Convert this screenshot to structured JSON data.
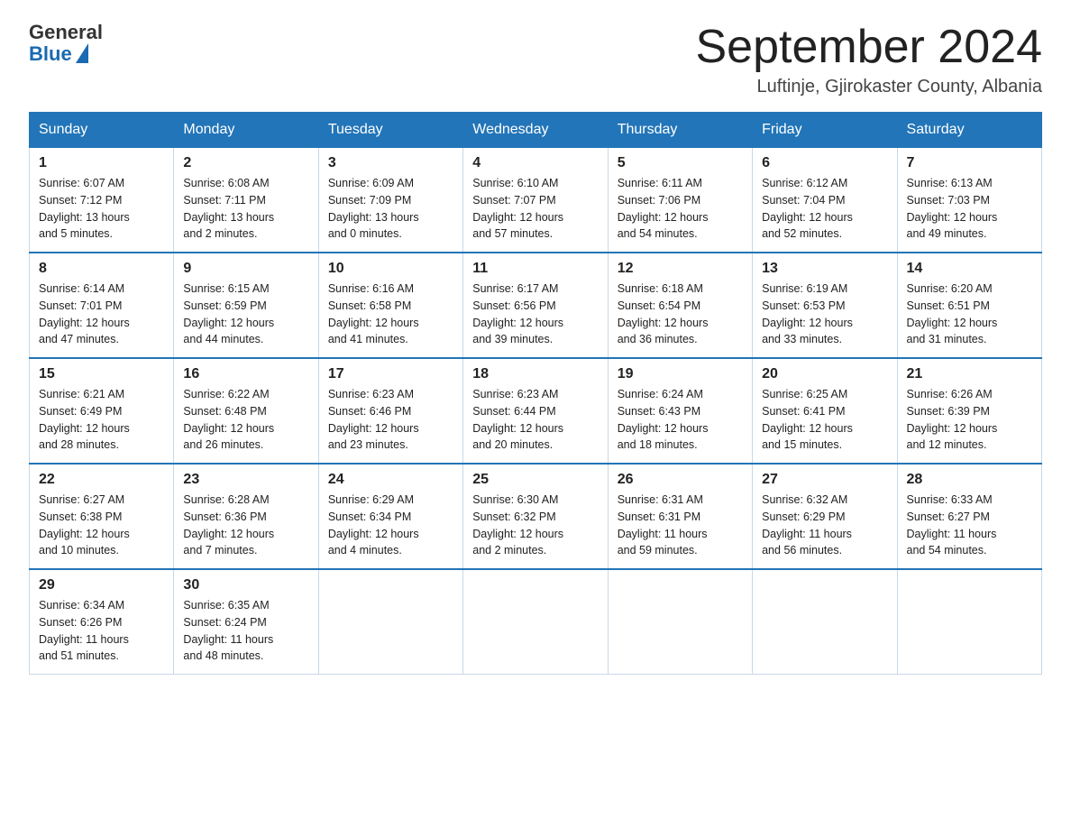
{
  "header": {
    "logo_general": "General",
    "logo_blue": "Blue",
    "month_title": "September 2024",
    "location": "Luftinje, Gjirokaster County, Albania"
  },
  "days_of_week": [
    "Sunday",
    "Monday",
    "Tuesday",
    "Wednesday",
    "Thursday",
    "Friday",
    "Saturday"
  ],
  "weeks": [
    [
      {
        "day": "1",
        "info": "Sunrise: 6:07 AM\nSunset: 7:12 PM\nDaylight: 13 hours\nand 5 minutes."
      },
      {
        "day": "2",
        "info": "Sunrise: 6:08 AM\nSunset: 7:11 PM\nDaylight: 13 hours\nand 2 minutes."
      },
      {
        "day": "3",
        "info": "Sunrise: 6:09 AM\nSunset: 7:09 PM\nDaylight: 13 hours\nand 0 minutes."
      },
      {
        "day": "4",
        "info": "Sunrise: 6:10 AM\nSunset: 7:07 PM\nDaylight: 12 hours\nand 57 minutes."
      },
      {
        "day": "5",
        "info": "Sunrise: 6:11 AM\nSunset: 7:06 PM\nDaylight: 12 hours\nand 54 minutes."
      },
      {
        "day": "6",
        "info": "Sunrise: 6:12 AM\nSunset: 7:04 PM\nDaylight: 12 hours\nand 52 minutes."
      },
      {
        "day": "7",
        "info": "Sunrise: 6:13 AM\nSunset: 7:03 PM\nDaylight: 12 hours\nand 49 minutes."
      }
    ],
    [
      {
        "day": "8",
        "info": "Sunrise: 6:14 AM\nSunset: 7:01 PM\nDaylight: 12 hours\nand 47 minutes."
      },
      {
        "day": "9",
        "info": "Sunrise: 6:15 AM\nSunset: 6:59 PM\nDaylight: 12 hours\nand 44 minutes."
      },
      {
        "day": "10",
        "info": "Sunrise: 6:16 AM\nSunset: 6:58 PM\nDaylight: 12 hours\nand 41 minutes."
      },
      {
        "day": "11",
        "info": "Sunrise: 6:17 AM\nSunset: 6:56 PM\nDaylight: 12 hours\nand 39 minutes."
      },
      {
        "day": "12",
        "info": "Sunrise: 6:18 AM\nSunset: 6:54 PM\nDaylight: 12 hours\nand 36 minutes."
      },
      {
        "day": "13",
        "info": "Sunrise: 6:19 AM\nSunset: 6:53 PM\nDaylight: 12 hours\nand 33 minutes."
      },
      {
        "day": "14",
        "info": "Sunrise: 6:20 AM\nSunset: 6:51 PM\nDaylight: 12 hours\nand 31 minutes."
      }
    ],
    [
      {
        "day": "15",
        "info": "Sunrise: 6:21 AM\nSunset: 6:49 PM\nDaylight: 12 hours\nand 28 minutes."
      },
      {
        "day": "16",
        "info": "Sunrise: 6:22 AM\nSunset: 6:48 PM\nDaylight: 12 hours\nand 26 minutes."
      },
      {
        "day": "17",
        "info": "Sunrise: 6:23 AM\nSunset: 6:46 PM\nDaylight: 12 hours\nand 23 minutes."
      },
      {
        "day": "18",
        "info": "Sunrise: 6:23 AM\nSunset: 6:44 PM\nDaylight: 12 hours\nand 20 minutes."
      },
      {
        "day": "19",
        "info": "Sunrise: 6:24 AM\nSunset: 6:43 PM\nDaylight: 12 hours\nand 18 minutes."
      },
      {
        "day": "20",
        "info": "Sunrise: 6:25 AM\nSunset: 6:41 PM\nDaylight: 12 hours\nand 15 minutes."
      },
      {
        "day": "21",
        "info": "Sunrise: 6:26 AM\nSunset: 6:39 PM\nDaylight: 12 hours\nand 12 minutes."
      }
    ],
    [
      {
        "day": "22",
        "info": "Sunrise: 6:27 AM\nSunset: 6:38 PM\nDaylight: 12 hours\nand 10 minutes."
      },
      {
        "day": "23",
        "info": "Sunrise: 6:28 AM\nSunset: 6:36 PM\nDaylight: 12 hours\nand 7 minutes."
      },
      {
        "day": "24",
        "info": "Sunrise: 6:29 AM\nSunset: 6:34 PM\nDaylight: 12 hours\nand 4 minutes."
      },
      {
        "day": "25",
        "info": "Sunrise: 6:30 AM\nSunset: 6:32 PM\nDaylight: 12 hours\nand 2 minutes."
      },
      {
        "day": "26",
        "info": "Sunrise: 6:31 AM\nSunset: 6:31 PM\nDaylight: 11 hours\nand 59 minutes."
      },
      {
        "day": "27",
        "info": "Sunrise: 6:32 AM\nSunset: 6:29 PM\nDaylight: 11 hours\nand 56 minutes."
      },
      {
        "day": "28",
        "info": "Sunrise: 6:33 AM\nSunset: 6:27 PM\nDaylight: 11 hours\nand 54 minutes."
      }
    ],
    [
      {
        "day": "29",
        "info": "Sunrise: 6:34 AM\nSunset: 6:26 PM\nDaylight: 11 hours\nand 51 minutes."
      },
      {
        "day": "30",
        "info": "Sunrise: 6:35 AM\nSunset: 6:24 PM\nDaylight: 11 hours\nand 48 minutes."
      },
      {
        "day": "",
        "info": ""
      },
      {
        "day": "",
        "info": ""
      },
      {
        "day": "",
        "info": ""
      },
      {
        "day": "",
        "info": ""
      },
      {
        "day": "",
        "info": ""
      }
    ]
  ]
}
